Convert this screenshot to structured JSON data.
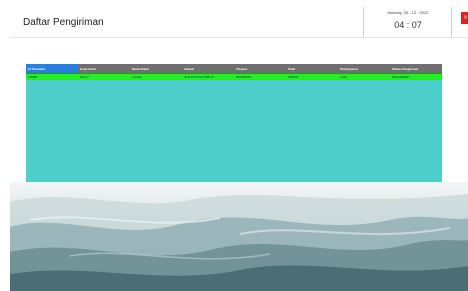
{
  "header": {
    "title": "Daftar Pengiriman",
    "date": "Monday, 26 - 12 - 2022",
    "time": "04 : 07",
    "close_label": "x"
  },
  "table": {
    "columns": [
      "Id Transaksi",
      "Sopir Kirim",
      "Nama Paket",
      "Alamat",
      "Telepon",
      "Total",
      "Pembayaran",
      "Status Pengiriman"
    ],
    "rows": [
      [
        "TR388",
        "Sato 2",
        "Cavaja",
        "JL.RAYA WAO 988 10",
        "081366754",
        "458108",
        "Cash",
        "DELIVERED"
      ]
    ]
  },
  "colors": {
    "accent_header": "#2a7de1",
    "table_bg": "#4ecfcb",
    "row_highlight": "#22ee22",
    "close_button": "#e02020"
  }
}
